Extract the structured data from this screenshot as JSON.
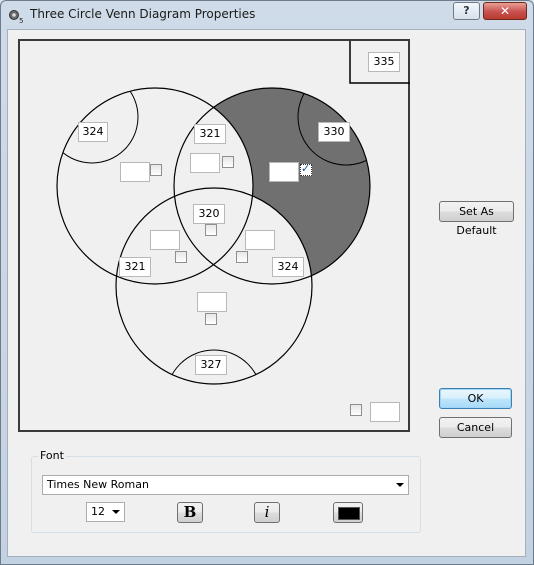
{
  "window": {
    "title": "Three Circle Venn Diagram Properties",
    "help_label": "?",
    "close_label": "✕",
    "app_icon": "venn-gear-icon"
  },
  "venn": {
    "outside_value": "335",
    "left_only": "324",
    "right_only": "330",
    "left_right_top": "321",
    "center": "320",
    "left_bottom": "321",
    "right_bottom": "324",
    "bottom_only": "327",
    "shaded_color": "#707070",
    "outline_color": "#000000"
  },
  "buttons": {
    "set_default": "Set As Default",
    "ok": "OK",
    "cancel": "Cancel"
  },
  "font": {
    "group_label": "Font",
    "family": "Times New Roman",
    "size": "12",
    "bold_label": "B",
    "italic_label": "i",
    "color": "#000000"
  }
}
